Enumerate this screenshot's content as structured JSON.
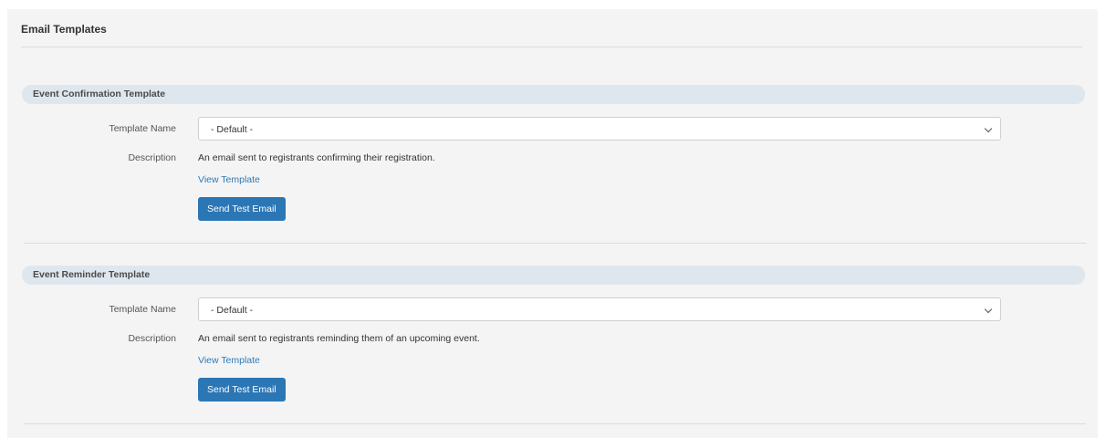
{
  "panel": {
    "title": "Email Templates"
  },
  "sections": [
    {
      "header": "Event Confirmation Template",
      "template_name_label": "Template Name",
      "template_name_value": "- Default -",
      "description_label": "Description",
      "description_text": "An email sent to registrants confirming their registration.",
      "view_link": "View Template",
      "send_button": "Send Test Email"
    },
    {
      "header": "Event Reminder Template",
      "template_name_label": "Template Name",
      "template_name_value": "- Default -",
      "description_label": "Description",
      "description_text": "An email sent to registrants reminding them of an upcoming event.",
      "view_link": "View Template",
      "send_button": "Send Test Email"
    }
  ],
  "colors": {
    "panel_bg": "#f4f4f4",
    "section_header_bg": "#dfe7ee",
    "link": "#2d7ab8",
    "button_bg": "#2b76b5"
  }
}
